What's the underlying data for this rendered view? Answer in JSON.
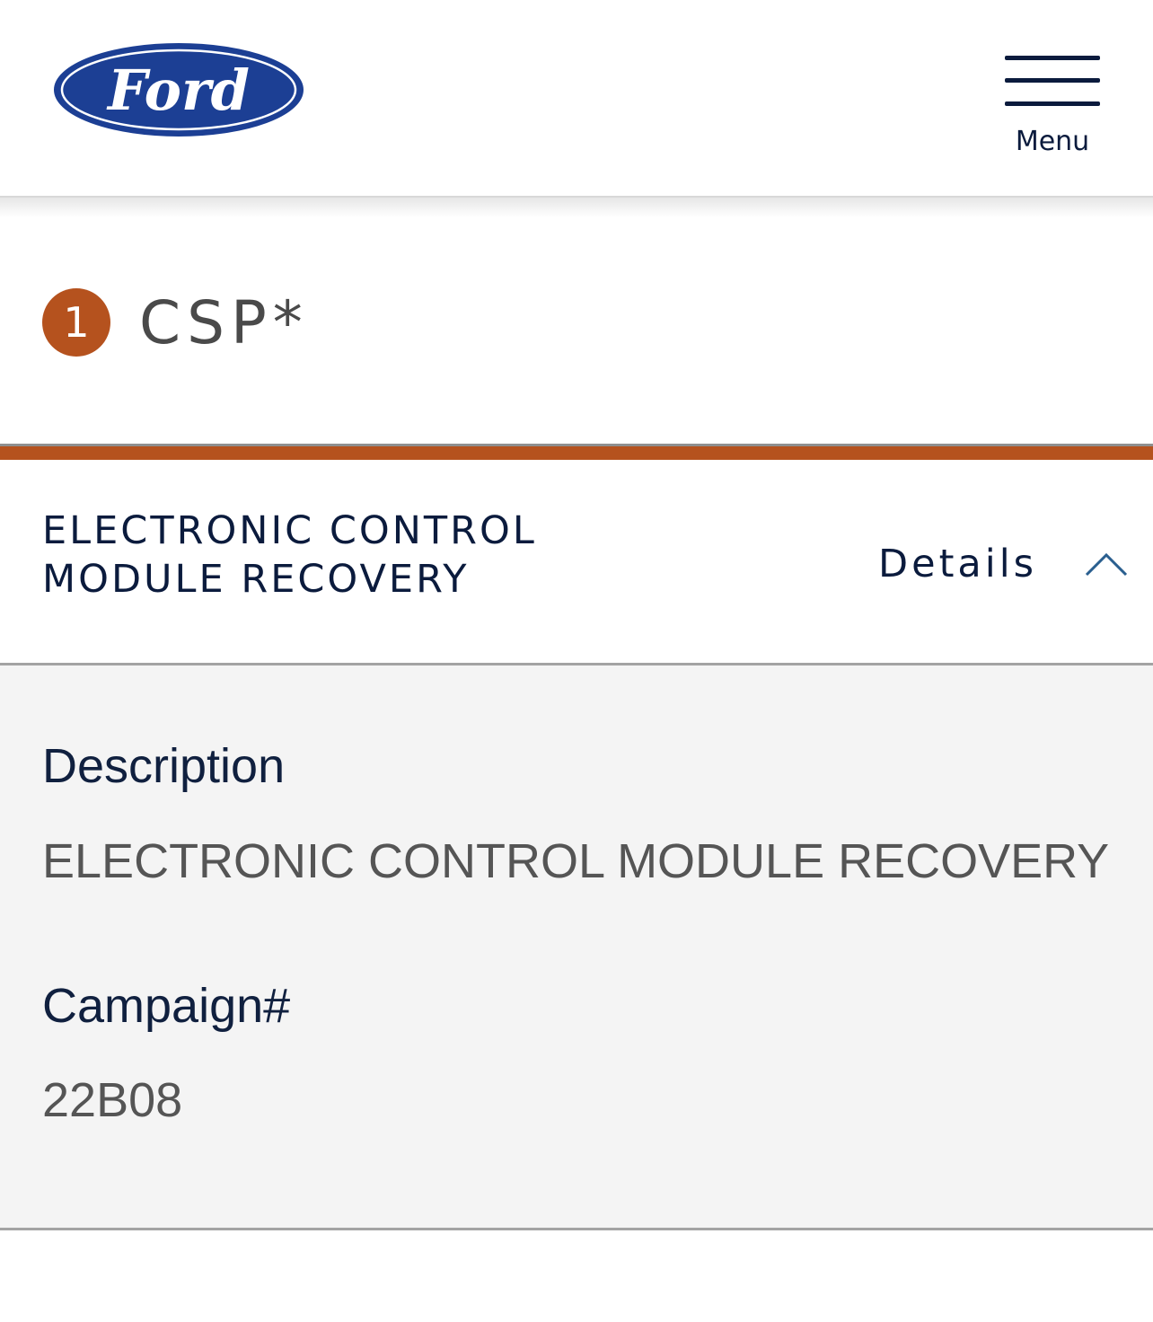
{
  "header": {
    "logo_text": "Ford",
    "logo_color": "#1c3f94",
    "menu_label": "Menu"
  },
  "step": {
    "number": "1",
    "title": "CSP*",
    "accent_color": "#b5521e"
  },
  "accordion": {
    "title": "ELECTRONIC CONTROL MODULE RECOVERY",
    "toggle_label": "Details",
    "expanded": true,
    "fields": {
      "description_label": "Description",
      "description_value": "ELECTRONIC CONTROL MODULE RECOVERY",
      "campaign_label": "Campaign#",
      "campaign_value": "22B08"
    }
  },
  "icons": {
    "menu": "hamburger-menu-icon",
    "toggle": "chevron-up-icon"
  }
}
